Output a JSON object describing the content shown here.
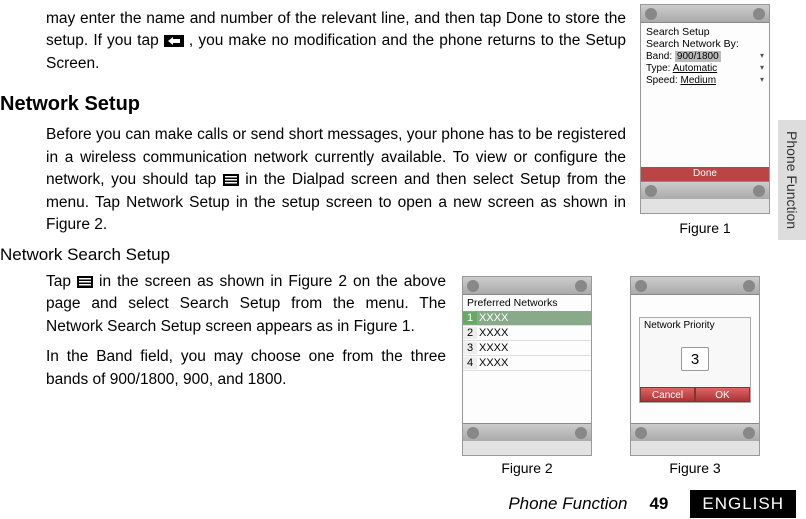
{
  "sideTab": "Phone Function",
  "intro": {
    "line1_pre": "may enter the name and number of the relevant line, and then tap Done to store the setup. If you tap ",
    "line1_post": " , you make no modification and the phone returns to the Setup Screen."
  },
  "networkSetup": {
    "heading": "Network Setup",
    "p1_pre": "Before you can make calls or send short messages, your phone has to be registered in a wireless communication network currently available. To view or configure the network, you should tap ",
    "p1_post": " in the Dialpad screen and then select Setup from the menu. Tap Network Setup in the setup screen to open a new screen as shown in Figure 2."
  },
  "searchSetup": {
    "heading": "Network Search Setup",
    "p1_pre": "Tap ",
    "p1_post": " in the screen as shown in Figure 2 on the above page and select Search Setup from the menu. The Network Search Setup screen appears as in Figure 1.",
    "p2": "In the Band field, you may choose one from the three bands of 900/1800, 900, and 1800."
  },
  "fig1": {
    "title": "Search Setup",
    "sub": "Search Network By:",
    "bandLabel": "Band:",
    "bandVal": "900/1800",
    "typeLabel": "Type:",
    "typeVal": "Automatic",
    "speedLabel": "Speed:",
    "speedVal": "Medium",
    "done": "Done",
    "caption": "Figure 1"
  },
  "fig2": {
    "title": "Preferred Networks",
    "rows": [
      {
        "n": "1",
        "v": "XXXX"
      },
      {
        "n": "2",
        "v": "XXXX"
      },
      {
        "n": "3",
        "v": "XXXX"
      },
      {
        "n": "4",
        "v": "XXXX"
      }
    ],
    "caption": "Figure 2"
  },
  "fig3": {
    "title": "Network Priority",
    "value": "3",
    "cancel": "Cancel",
    "ok": "OK",
    "caption": "Figure 3"
  },
  "footer": {
    "section": "Phone Function",
    "page": "49",
    "lang": "ENGLISH"
  }
}
